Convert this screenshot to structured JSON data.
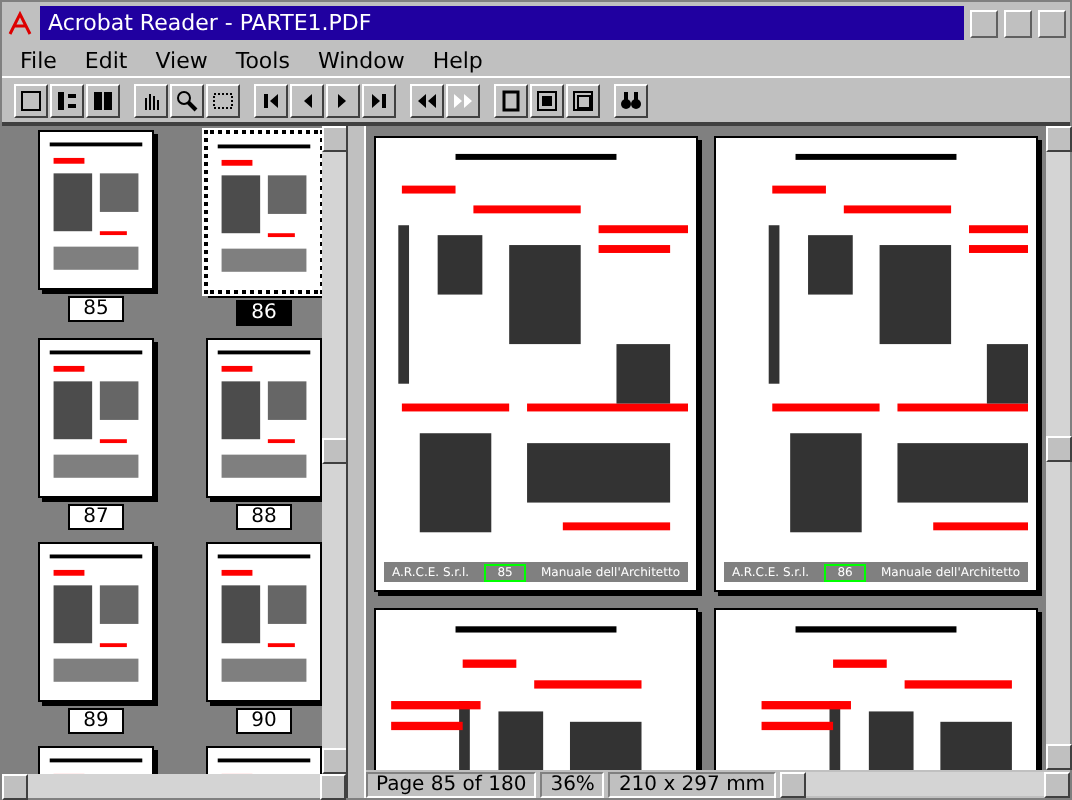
{
  "window": {
    "title": "Acrobat Reader - PARTE1.PDF"
  },
  "menus": [
    "File",
    "Edit",
    "View",
    "Tools",
    "Window",
    "Help"
  ],
  "thumbnails": [
    {
      "label": "85",
      "selected": false
    },
    {
      "label": "86",
      "selected": true
    },
    {
      "label": "87",
      "selected": false
    },
    {
      "label": "88",
      "selected": false
    },
    {
      "label": "89",
      "selected": false
    },
    {
      "label": "90",
      "selected": false
    },
    {
      "selected": false
    },
    {
      "selected": false
    }
  ],
  "pages": [
    {
      "footer_left": "A.R.C.E. S.r.l.",
      "page_number": "85",
      "footer_right": "Manuale dell'Architetto"
    },
    {
      "footer_left": "A.R.C.E. S.r.l.",
      "page_number": "86",
      "footer_right": "Manuale dell'Architetto"
    }
  ],
  "status_bar": {
    "page": "Page 85 of 180",
    "zoom": "36%",
    "size": "210 x 297 mm"
  }
}
